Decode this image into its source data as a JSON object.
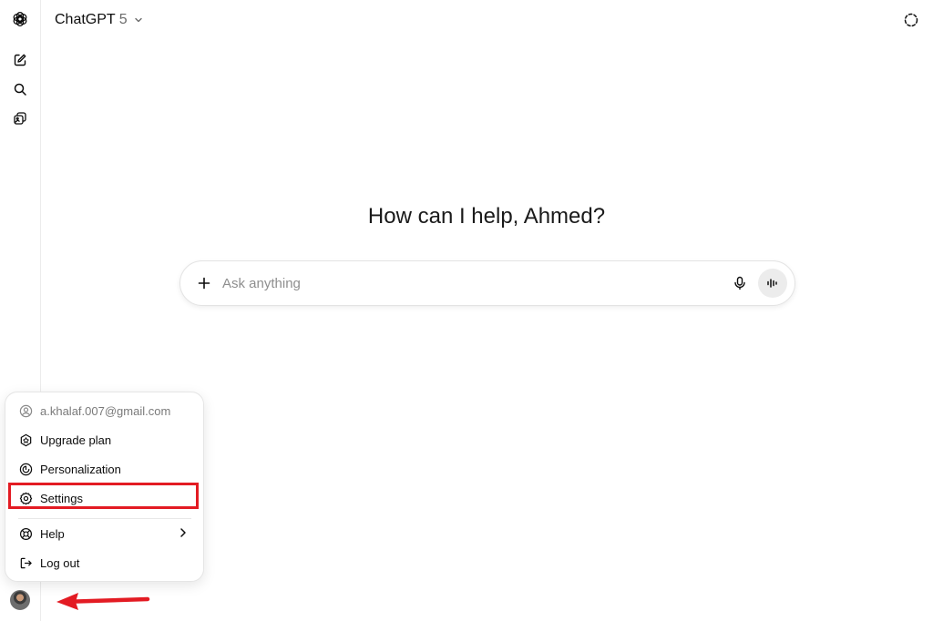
{
  "header": {
    "model_name": "ChatGPT",
    "model_version": "5"
  },
  "main": {
    "greeting": "How can I help, Ahmed?",
    "composer": {
      "placeholder": "Ask anything"
    }
  },
  "account_menu": {
    "email": "a.khalaf.007@gmail.com",
    "items": [
      {
        "label": "Upgrade plan",
        "icon": "upgrade-icon"
      },
      {
        "label": "Personalization",
        "icon": "personalization-icon"
      },
      {
        "label": "Settings",
        "icon": "gear-icon"
      },
      {
        "label": "Help",
        "icon": "help-icon"
      },
      {
        "label": "Log out",
        "icon": "logout-icon"
      }
    ]
  },
  "annotation": {
    "highlight_color": "#e31b23",
    "highlighted_item": "Settings"
  }
}
